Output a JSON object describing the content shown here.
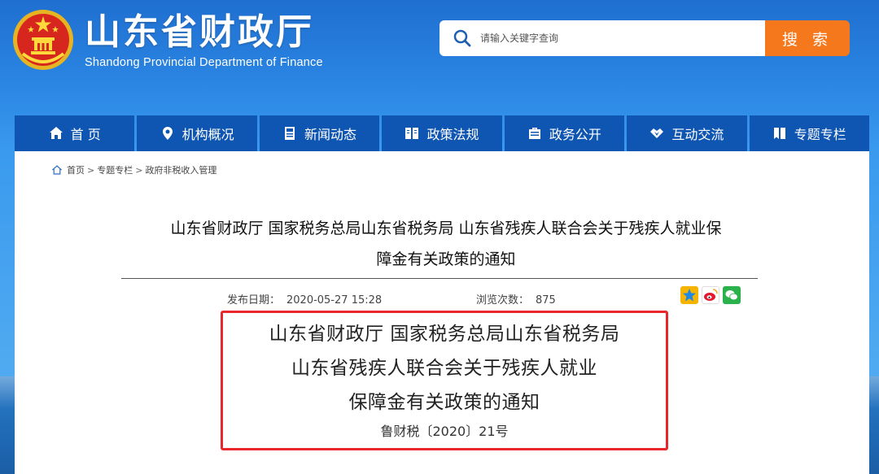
{
  "header": {
    "site_title": "山东省财政厅",
    "site_subtitle": "Shandong Provincial Department of Finance",
    "search_placeholder": "请输入关键字查询",
    "search_button": "搜 索"
  },
  "nav": {
    "items": [
      {
        "label": "首 页",
        "icon": "home-icon"
      },
      {
        "label": "机构概况",
        "icon": "location-pin-icon"
      },
      {
        "label": "新闻动态",
        "icon": "news-icon"
      },
      {
        "label": "政策法规",
        "icon": "book-icon"
      },
      {
        "label": "政务公开",
        "icon": "briefcase-icon"
      },
      {
        "label": "互动交流",
        "icon": "handshake-icon"
      },
      {
        "label": "专题专栏",
        "icon": "bookmark-icon"
      }
    ]
  },
  "breadcrumb": {
    "items": [
      "首页",
      "专题专栏",
      "政府非税收入管理"
    ],
    "separator": ">"
  },
  "article": {
    "title_line1": "山东省财政厅 国家税务总局山东省税务局 山东省残疾人联合会关于残疾人就业保",
    "title_line2": "障金有关政策的通知",
    "publish_label": "发布日期：",
    "publish_date": "2020-05-27 15:28",
    "views_label": "浏览次数：",
    "views": "875",
    "doc_title_line1": "山东省财政厅 国家税务总局山东省税务局",
    "doc_title_line2": "山东省残疾人联合会关于残疾人就业",
    "doc_title_line3": "保障金有关政策的通知",
    "doc_number": "鲁财税〔2020〕21号"
  },
  "share_icons": [
    "qzone-icon",
    "weibo-icon",
    "wechat-icon"
  ],
  "colors": {
    "nav_bg": "#0f55b2",
    "search_button": "#f5781d",
    "highlight_border": "#e8262b"
  }
}
